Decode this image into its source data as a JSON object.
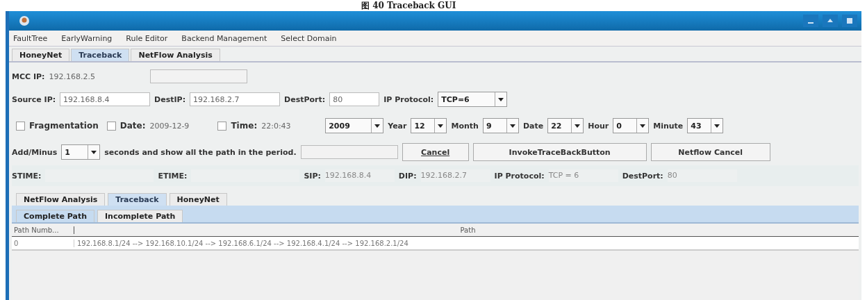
{
  "caption": "图 40   Traceback GUI",
  "menu": [
    "FaultTree",
    "EarlyWarning",
    "Rule Editor",
    "Backend Management",
    "Select Domain"
  ],
  "tabs": [
    {
      "label": "HoneyNet",
      "selected": false
    },
    {
      "label": "Traceback",
      "selected": true
    },
    {
      "label": "NetFlow Analysis",
      "selected": false
    }
  ],
  "mcc": {
    "label": "MCC IP:",
    "value": "192.168.2.5"
  },
  "query": [
    {
      "label": "Source IP:",
      "value": "192.168.8.4",
      "kind": "field"
    },
    {
      "label": "DestIP:",
      "value": "192.168.2.7",
      "kind": "field"
    },
    {
      "label": "DestPort:",
      "value": "80",
      "kind": "short"
    },
    {
      "label": "IP Protocol:",
      "value": "TCP=6",
      "kind": "combo"
    }
  ],
  "filters": [
    {
      "label": "Fragmentation",
      "checked": false
    },
    {
      "label": "Date:",
      "checked": false,
      "value": "2009-12-9"
    },
    {
      "label": "Time:",
      "checked": false,
      "value": "22:0:43"
    }
  ],
  "time_combos": [
    {
      "value": "2009"
    },
    {
      "label": "Year",
      "value": "12"
    },
    {
      "label": "Month",
      "value": "9"
    },
    {
      "label": "Date",
      "value": "22"
    },
    {
      "label": "Hour",
      "value": "0"
    },
    {
      "label": "Minute",
      "value": "43"
    }
  ],
  "addminus": {
    "label": "Add/Minus",
    "value": "1",
    "text": "seconds and show all the path in the period."
  },
  "buttons": [
    "Cancel",
    "InvokeTraceBackButton",
    "Netflow Cancel"
  ],
  "result": [
    {
      "label": "STIME:"
    },
    {
      "label": "ETIME:"
    },
    {
      "label": "SIP:",
      "value": "192.168.8.4"
    },
    {
      "label": "DIP:",
      "value": "192.168.2.7"
    },
    {
      "label": "IP Protocol:",
      "value": "TCP = 6"
    },
    {
      "label": "DestPort:",
      "value": "80"
    }
  ],
  "lower_tabs": [
    {
      "label": "NetFlow Analysis",
      "selected": false
    },
    {
      "label": "Traceback",
      "selected": true
    },
    {
      "label": "HoneyNet",
      "selected": false
    }
  ],
  "path_tabs": [
    {
      "label": "Complete Path",
      "selected": true
    },
    {
      "label": "Incomplete Path",
      "selected": false
    }
  ],
  "table": {
    "columns": [
      "Path Numb...",
      "Path"
    ],
    "rows": [
      [
        "0",
        "192.168.8.1/24 --> 192.168.10.1/24 --> 192.168.6.1/24 --> 192.168.4.1/24 --> 192.168.2.1/24"
      ]
    ]
  }
}
